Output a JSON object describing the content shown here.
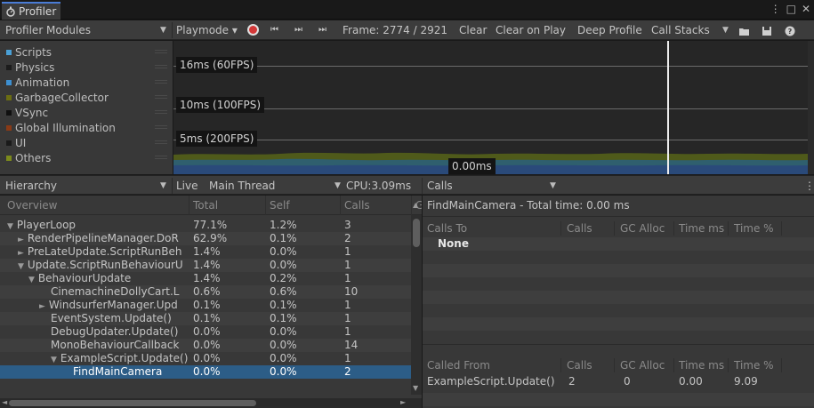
{
  "titlebar": {
    "tab_label": "Profiler",
    "menu_icon": "kebab-icon",
    "maximize_icon": "maximize-icon",
    "close_icon": "close-icon"
  },
  "toolbar": {
    "modules_label": "Profiler Modules",
    "playmode_label": "Playmode ▾",
    "frame_label": "Frame: 2774 / 2921",
    "clear": "Clear",
    "clear_on_play": "Clear on Play",
    "deep_profile": "Deep Profile",
    "call_stacks": "Call Stacks"
  },
  "modules": [
    {
      "label": "Scripts",
      "color": "#4aa0d6"
    },
    {
      "label": "Physics",
      "color": "#1c1c1c"
    },
    {
      "label": "Animation",
      "color": "#3d8fd0"
    },
    {
      "label": "GarbageCollector",
      "color": "#6b6d12"
    },
    {
      "label": "VSync",
      "color": "#101010"
    },
    {
      "label": "Global Illumination",
      "color": "#8a3a16"
    },
    {
      "label": "UI",
      "color": "#1a1a1a"
    },
    {
      "label": "Others",
      "color": "#7c8a1c"
    }
  ],
  "graph": {
    "line_60": "16ms (60FPS)",
    "line_100": "10ms (100FPS)",
    "line_200": "5ms (200FPS)",
    "cursor_value": "0.00ms"
  },
  "hierarchy_bar": {
    "view_label": "Hierarchy",
    "live_label": "Live",
    "thread_label": "Main Thread",
    "cpu_label": "CPU:3.09ms",
    "calls_view_label": "Calls"
  },
  "table": {
    "headers": [
      "Overview",
      "Total",
      "Self",
      "Calls"
    ],
    "rows": [
      {
        "name": "PlayerLoop",
        "total": "77.1%",
        "self": "1.2%",
        "calls": "3",
        "arrow": "▼"
      },
      {
        "name": "RenderPipelineManager.DoR",
        "total": "62.9%",
        "self": "0.1%",
        "calls": "2",
        "arrow": "►"
      },
      {
        "name": "PreLateUpdate.ScriptRunBeh",
        "total": "1.4%",
        "self": "0.0%",
        "calls": "1",
        "arrow": "►"
      },
      {
        "name": "Update.ScriptRunBehaviourU",
        "total": "1.4%",
        "self": "0.0%",
        "calls": "1",
        "arrow": "▼"
      },
      {
        "name": "BehaviourUpdate",
        "total": "1.4%",
        "self": "0.2%",
        "calls": "1",
        "arrow": "▼"
      },
      {
        "name": "CinemachineDollyCart.L",
        "total": "0.6%",
        "self": "0.6%",
        "calls": "10",
        "arrow": ""
      },
      {
        "name": "WindsurferManager.Upd",
        "total": "0.1%",
        "self": "0.1%",
        "calls": "1",
        "arrow": "►"
      },
      {
        "name": "EventSystem.Update()",
        "total": "0.1%",
        "self": "0.1%",
        "calls": "1",
        "arrow": ""
      },
      {
        "name": "DebugUpdater.Update()",
        "total": "0.0%",
        "self": "0.0%",
        "calls": "1",
        "arrow": ""
      },
      {
        "name": "MonoBehaviourCallback",
        "total": "0.0%",
        "self": "0.0%",
        "calls": "14",
        "arrow": ""
      },
      {
        "name": "ExampleScript.Update()",
        "total": "0.0%",
        "self": "0.0%",
        "calls": "1",
        "arrow": "▼"
      },
      {
        "name": "FindMainCamera",
        "total": "0.0%",
        "self": "0.0%",
        "calls": "2",
        "arrow": ""
      }
    ]
  },
  "calls_panel": {
    "title": "FindMainCamera - Total time: 0.00 ms",
    "calls_to_headers": [
      "Calls To",
      "Calls",
      "GC Alloc",
      "Time ms",
      "Time %"
    ],
    "calls_to_rows": [
      {
        "name": "None"
      }
    ],
    "called_from_headers": [
      "Called From",
      "Calls",
      "GC Alloc",
      "Time ms",
      "Time %"
    ],
    "called_from_rows": [
      {
        "name": "ExampleScript.Update()",
        "calls": "2",
        "gc": "0",
        "time_ms": "0.00",
        "time_pct": "9.09"
      }
    ]
  }
}
